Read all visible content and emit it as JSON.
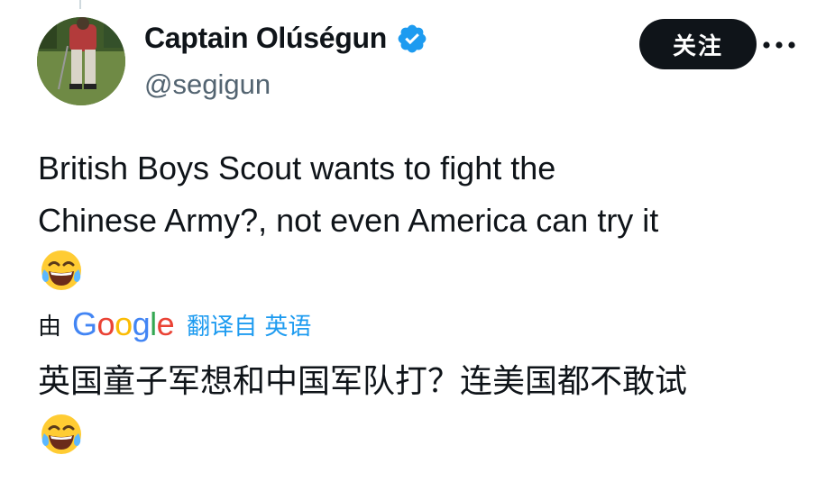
{
  "author": {
    "name": "Captain Olúségun",
    "handle": "@segigun"
  },
  "actions": {
    "follow_label": "关注"
  },
  "tweet": {
    "text_line_1": "British Boys Scout wants to fight the",
    "text_line_2": "Chinese Army?, not even America can try it",
    "emoji": "face-with-tears-of-joy"
  },
  "translation": {
    "prefix": "由",
    "provider": "Google",
    "link": "翻译自 英语",
    "text": "英国童子军想和中国军队打？连美国都不敢试"
  },
  "colors": {
    "text": "#0f1419",
    "secondary": "#536471",
    "link": "#1d9bf0",
    "verified": "#1d9bf0",
    "follow_bg": "#0f1419"
  },
  "icons": [
    "verified-badge-icon",
    "more-options-icon",
    "tears-of-joy-emoji"
  ]
}
